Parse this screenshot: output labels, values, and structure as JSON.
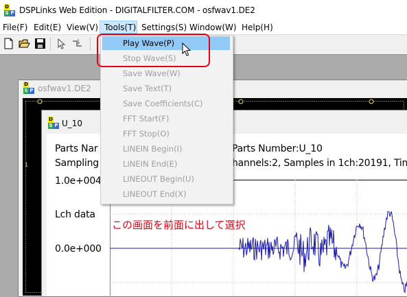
{
  "window": {
    "title": "DSPLinks Web Edition - DIGITALFILTER.COM - osfwav1.DE2"
  },
  "icon": {
    "letters": [
      "D",
      "S",
      "P",
      ""
    ]
  },
  "menubar": {
    "items": [
      "File(F)",
      "Edit(E)",
      "View(V)",
      "Tools(T)",
      "Settings(S)",
      "Window(W)",
      "Help(H)"
    ]
  },
  "tools_menu": {
    "items": [
      "Play Wave(P)",
      "Stop Wave(S)",
      "Save Wave(W)",
      "Save Text(T)",
      "Save Coefficients(C)",
      "FFT Start(F)",
      "FFT Stop(O)",
      "LINEIN Begin(I)",
      "LINEIN End(E)",
      "LINEOUT Begin(U)",
      "LINEOUT End(X)"
    ],
    "highlighted": "Play Wave(P)"
  },
  "child_window_back": {
    "title": "osfwav1.DE2",
    "left_marker": "1"
  },
  "child_window_front": {
    "title": "U_10",
    "info_line1_left": "Parts Nar",
    "info_line1_right": "Parts Number:U_10",
    "info_line2_left": "Sampling",
    "info_line2_right": "hannels:2, Samples in 1ch:20191, Tim",
    "y_top_label": "1.0e+004",
    "series_label": "Lch data",
    "y_zero_label": "0.0e+000"
  },
  "annotation": {
    "text": "この画面を前面に出して選択"
  },
  "colors": {
    "highlight": "#91c9f7",
    "annotation": "#e60012",
    "wave": "#1a1aa8",
    "disabled_text": "#9d9d9d"
  }
}
